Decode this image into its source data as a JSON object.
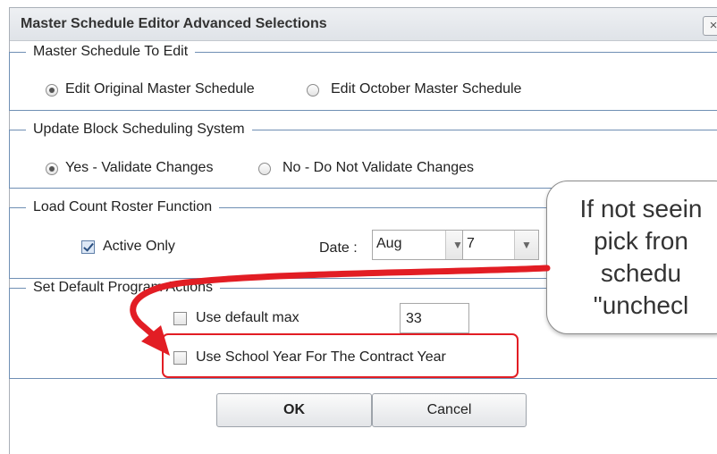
{
  "dialog": {
    "title": "Master Schedule Editor Advanced Selections",
    "close_glyph": "×"
  },
  "master_schedule": {
    "legend": "Master Schedule To Edit",
    "options": [
      {
        "label": "Edit Original Master Schedule",
        "checked": true
      },
      {
        "label": "Edit October Master Schedule",
        "checked": false
      }
    ]
  },
  "block_scheduling": {
    "legend": "Update Block Scheduling System",
    "options": [
      {
        "label": "Yes - Validate Changes",
        "checked": true
      },
      {
        "label": "No - Do Not Validate Changes",
        "checked": false
      }
    ]
  },
  "load_count": {
    "legend": "Load Count Roster Function",
    "active_only_label": "Active Only",
    "active_only_checked": true,
    "date_label": "Date :",
    "month_value": "Aug",
    "day_value": "7"
  },
  "default_program": {
    "legend": "Set Default Program Actions",
    "use_default_max_label": "Use default max",
    "use_default_max_checked": false,
    "default_max_value": "33",
    "school_year_label": "Use School Year For The Contract Year",
    "school_year_checked": false
  },
  "buttons": {
    "ok_label": "OK",
    "cancel_label": "Cancel"
  },
  "callout": {
    "lines": [
      "If not seein",
      "pick fron",
      "schedu",
      "\"unchecl"
    ]
  },
  "colors": {
    "highlight": "#e21d24",
    "group_border": "#6f8fb4"
  },
  "icons": {
    "close": "close-icon",
    "dropdown": "chevron-down-icon",
    "annotation_arrow": "red-arrow-icon"
  }
}
